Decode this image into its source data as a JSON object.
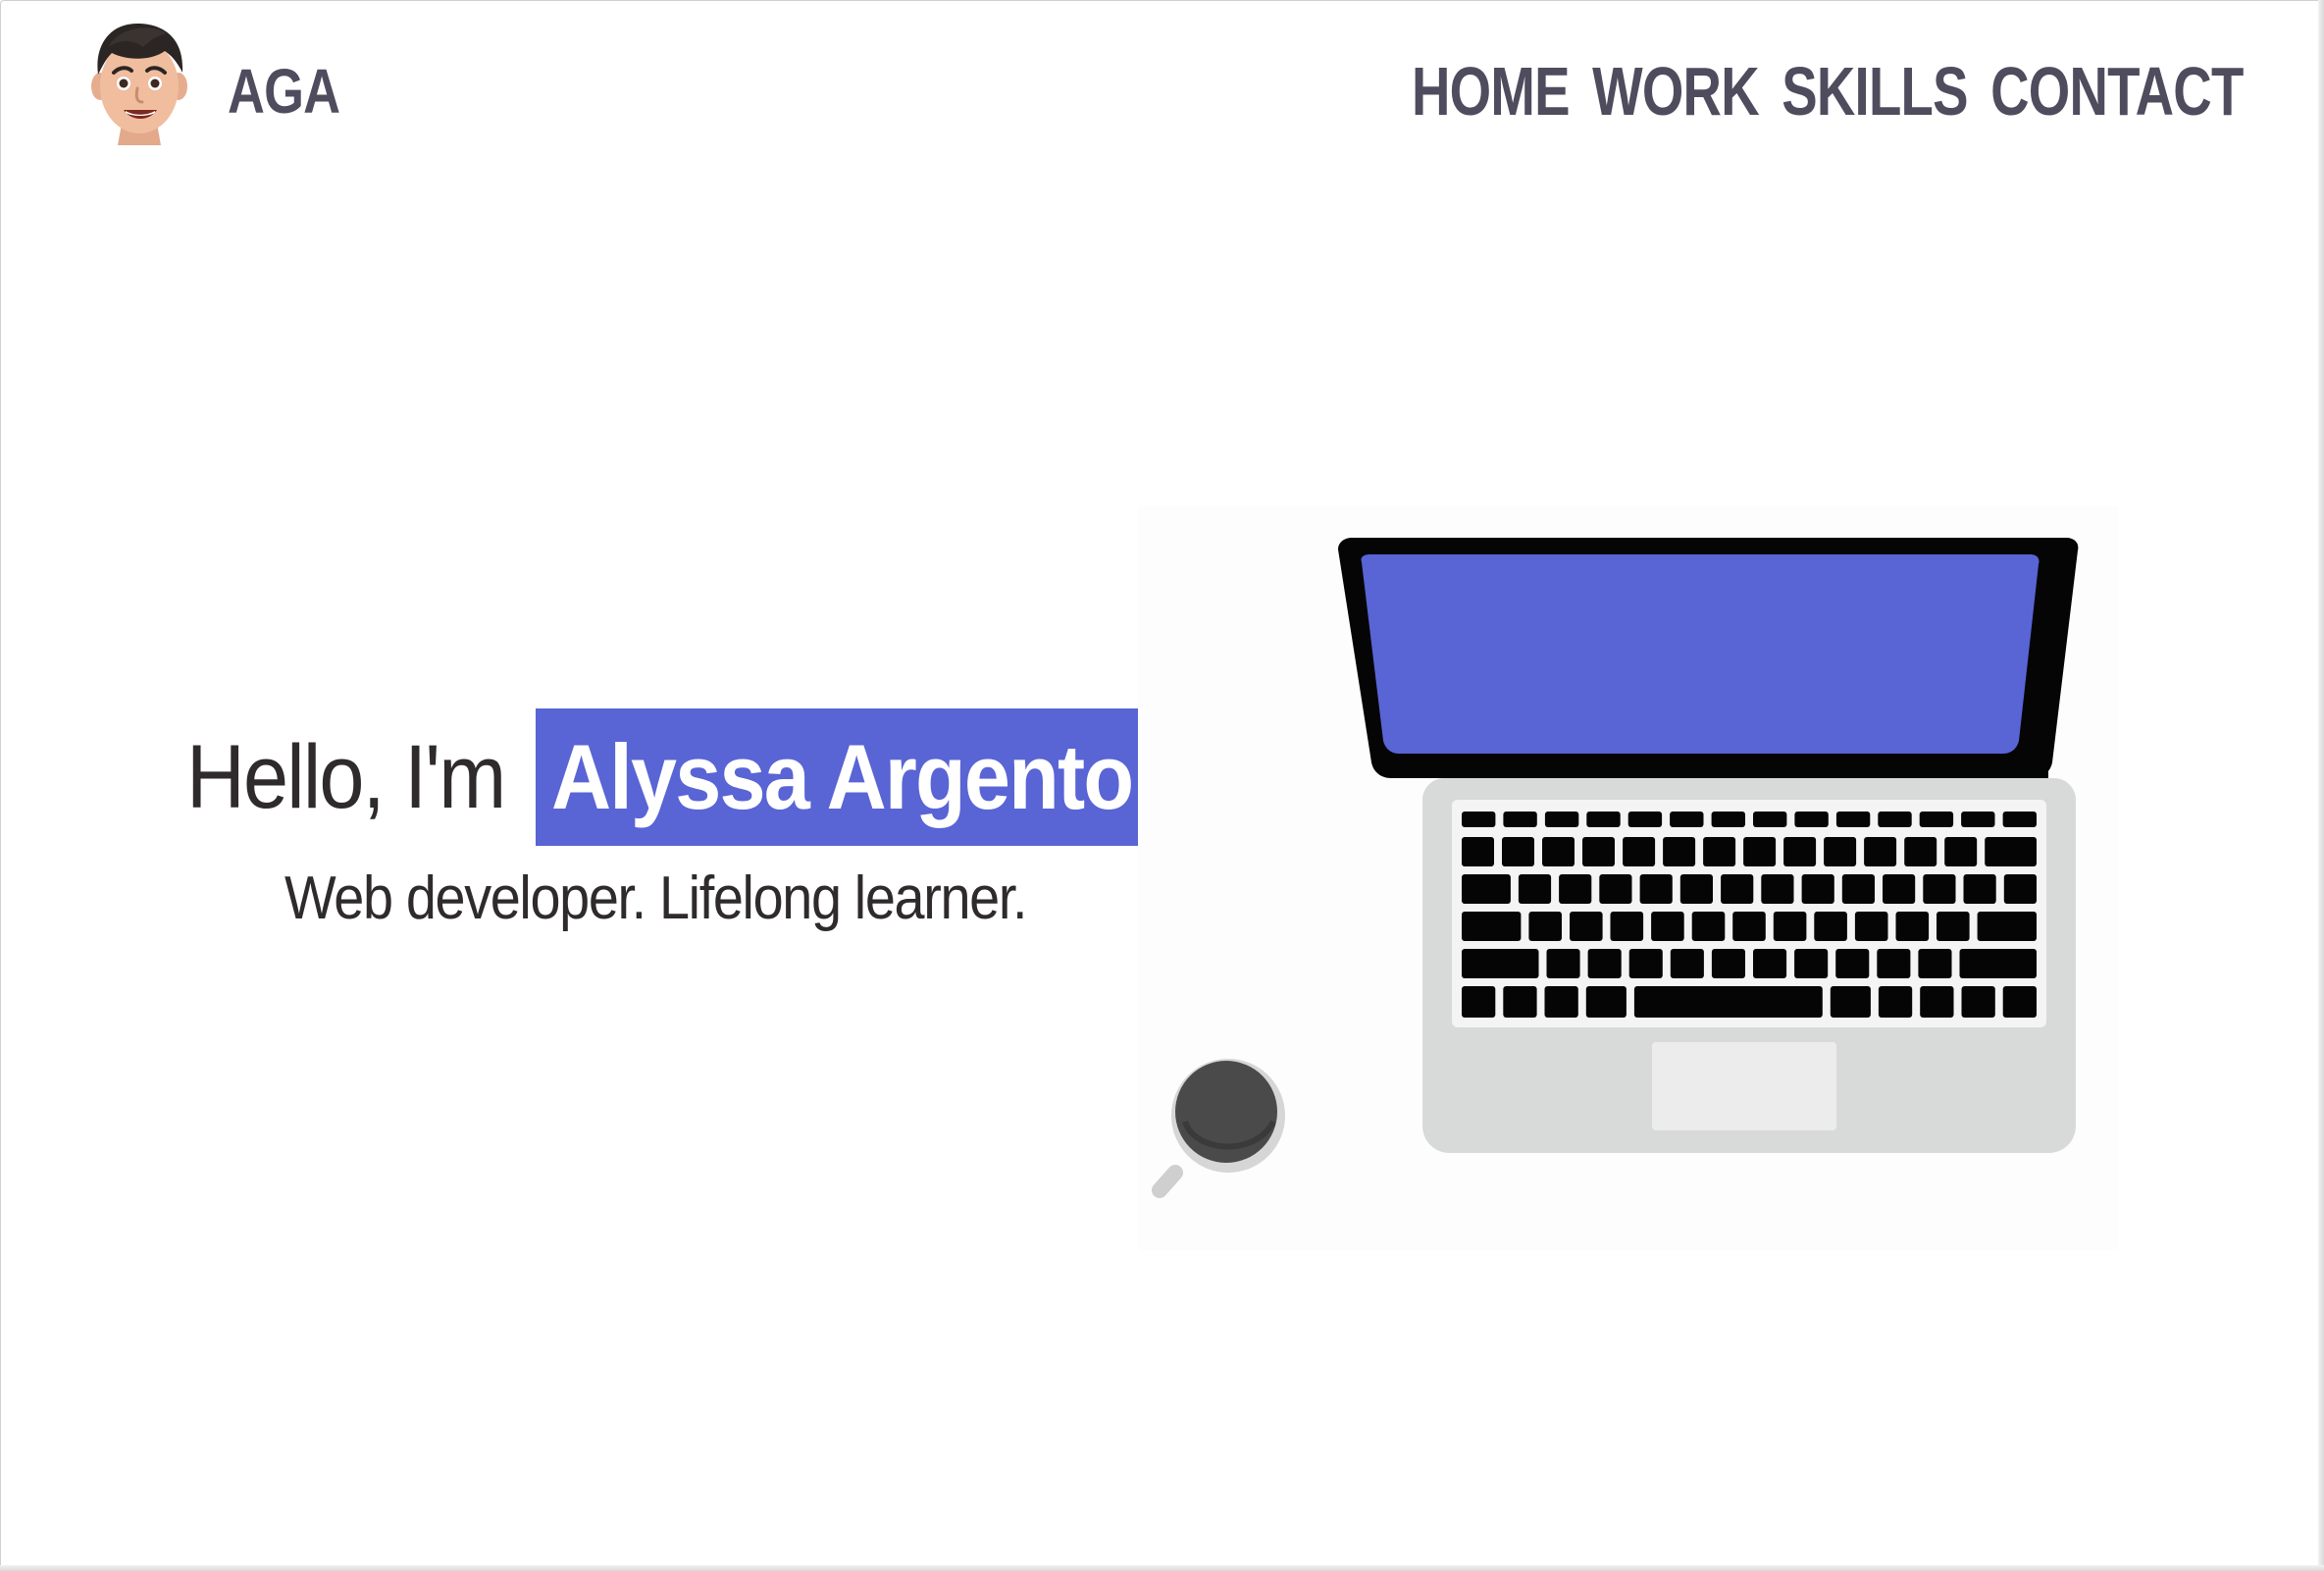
{
  "header": {
    "logo_text": "AGA",
    "nav": [
      "HOME",
      "WORK",
      "SKILLS",
      "CONTACT"
    ]
  },
  "hero": {
    "greeting": "Hello, I'm",
    "name": "Alyssa Argento",
    "tagline": "Web developer. Lifelong learner."
  },
  "colors": {
    "accent": "#5964d5",
    "nav_text": "#4f4c5e",
    "body_text": "#2f2a2c",
    "laptop_body": "#d8dad9",
    "laptop_screen": "#5964d5"
  },
  "icons": {
    "avatar": "memoji-avatar",
    "illustration": "laptop-and-coffee-illustration"
  }
}
